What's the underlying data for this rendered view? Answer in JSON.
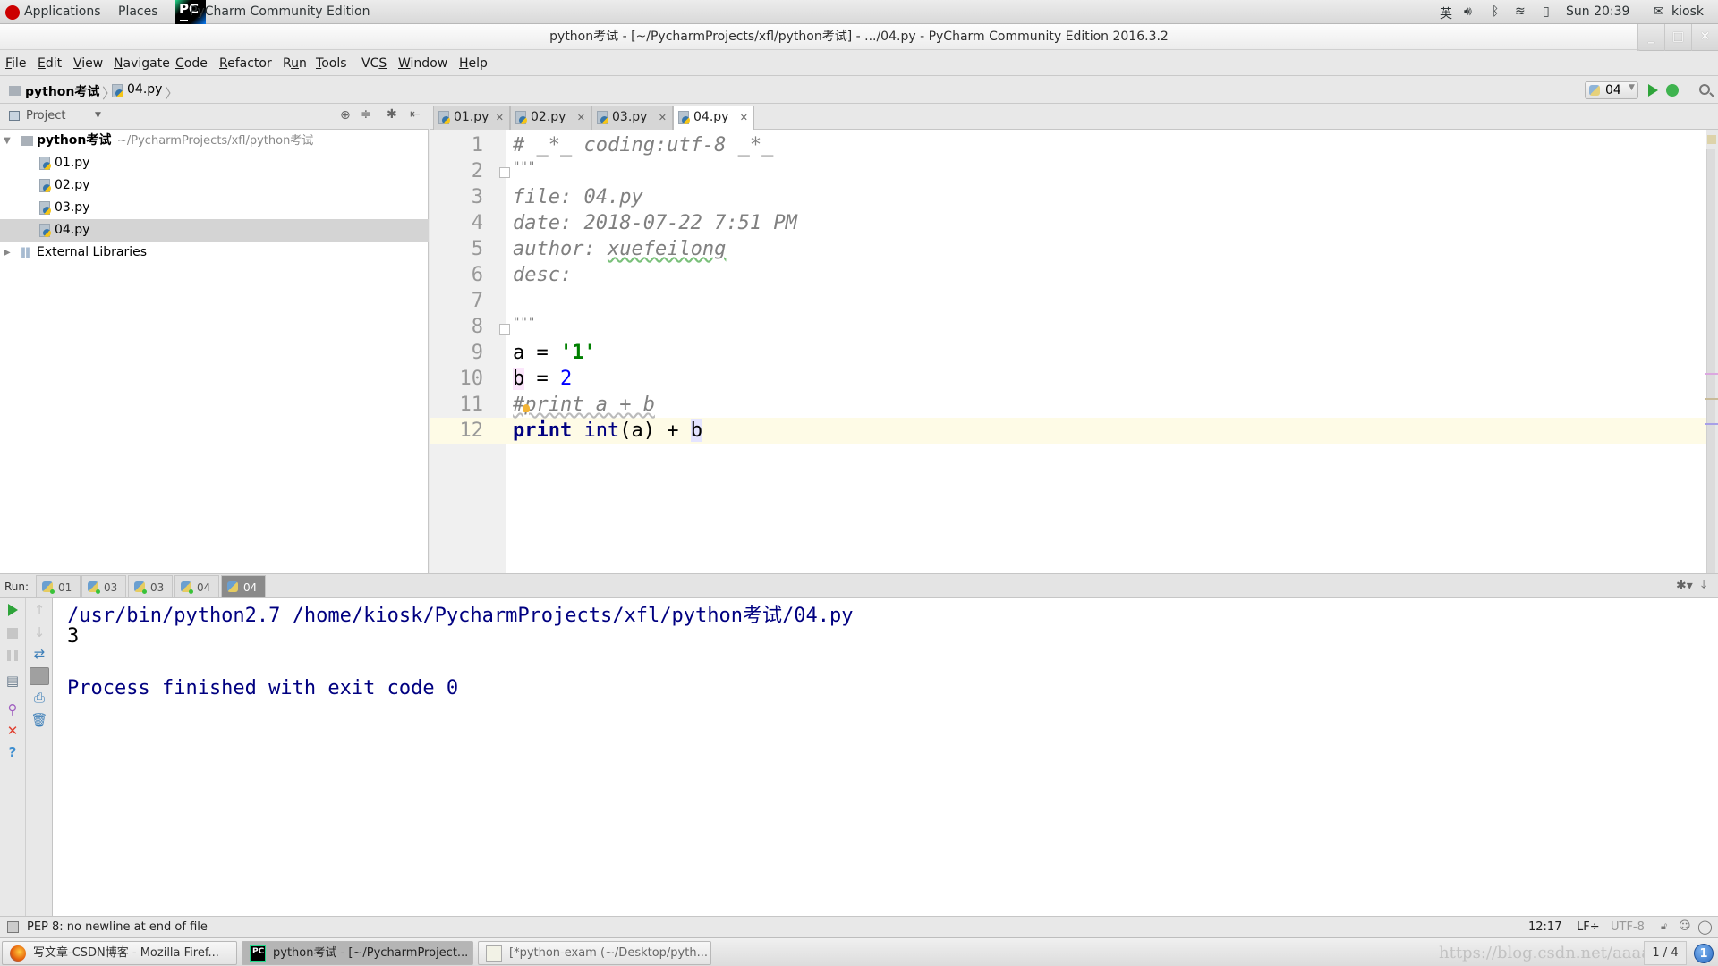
{
  "topbar": {
    "applications": "Applications",
    "places": "Places",
    "active_app": "PyCharm Community Edition",
    "active_app_badge": "PC",
    "input_method": "英",
    "clock": "Sun 20:39",
    "user": "kiosk"
  },
  "window": {
    "title": "python考试 - [~/PycharmProjects/xfl/python考试] - .../04.py - PyCharm Community Edition 2016.3.2",
    "minimize": "_",
    "maximize": "□",
    "close": "✕"
  },
  "menu": [
    "File",
    "Edit",
    "View",
    "Navigate",
    "Code",
    "Refactor",
    "Run",
    "Tools",
    "VCS",
    "Window",
    "Help"
  ],
  "navbar": {
    "breadcrumb": [
      "python考试",
      "04.py"
    ],
    "run_config": "04"
  },
  "project": {
    "header": "Project",
    "root": {
      "name": "python考试",
      "path": "~/PycharmProjects/xfl/python考试"
    },
    "files": [
      "01.py",
      "02.py",
      "03.py",
      "04.py"
    ],
    "selected": "04.py",
    "external": "External Libraries"
  },
  "tabs": [
    {
      "label": "01.py",
      "active": false
    },
    {
      "label": "02.py",
      "active": false
    },
    {
      "label": "03.py",
      "active": false
    },
    {
      "label": "04.py",
      "active": true
    }
  ],
  "editor": {
    "line_numbers": [
      "1",
      "2",
      "3",
      "4",
      "5",
      "6",
      "7",
      "8",
      "9",
      "10",
      "11",
      "12"
    ],
    "lines": {
      "l1": "# _*_ coding:utf-8 _*_",
      "l2": "\"\"\"",
      "l3": "file: 04.py",
      "l4": "date: 2018-07-22 7:51 PM",
      "l5_key": "author: ",
      "l5_val": "xuefeilong",
      "l6": "desc:",
      "l8": "\"\"\"",
      "l9_a": "a = ",
      "l9_str": "'1'",
      "l10_b": "b",
      "l10_eq": " = ",
      "l10_num": "2",
      "l11": "#print a + b",
      "l12_kw": "print",
      "l12_fn": " int",
      "l12_rest": "(a) + ",
      "l12_b": "b"
    },
    "current_line": 12
  },
  "run": {
    "label": "Run:",
    "tabs": [
      "01",
      "03",
      "03",
      "04",
      "04"
    ],
    "active_tab_index": 4,
    "output": [
      "/usr/bin/python2.7 /home/kiosk/PycharmProjects/xfl/python考试/04.py",
      "3",
      "",
      "Process finished with exit code 0"
    ]
  },
  "status": {
    "message": "PEP 8: no newline at end of file",
    "position": "12:17",
    "line_sep": "LF÷",
    "encoding": "UTF-8"
  },
  "taskbar": {
    "tasks": [
      {
        "label": "写文章-CSDN博客 - Mozilla Firef...",
        "active": false
      },
      {
        "label": "python考试 - [~/PycharmProject...",
        "active": true
      },
      {
        "label": "[*python-exam (~/Desktop/pyth...",
        "active": false
      }
    ],
    "watermark": "https://blog.csdn.net/aaaaaab",
    "workspace": "1 / 4",
    "notifications": "1"
  }
}
